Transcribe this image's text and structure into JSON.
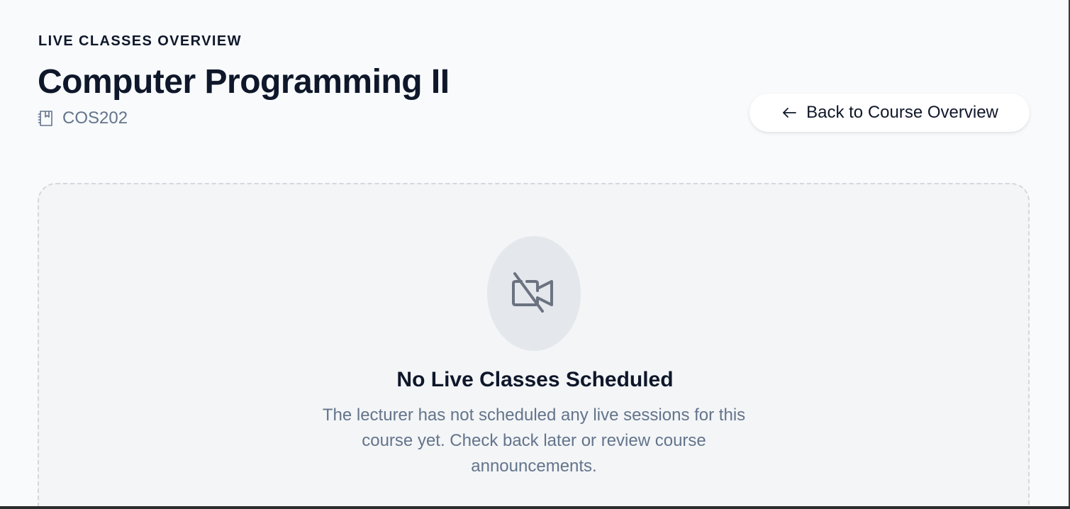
{
  "header": {
    "eyebrow": "LIVE CLASSES OVERVIEW",
    "course_title": "Computer Programming II",
    "course_code": "COS202",
    "course_code_icon": "book-icon"
  },
  "actions": {
    "back_label": "Back to Course Overview",
    "back_icon": "arrow-left-icon"
  },
  "empty_state": {
    "icon": "video-off-icon",
    "title": "No Live Classes Scheduled",
    "description": "The lecturer has not scheduled any live sessions for this course yet. Check back later or review course announcements."
  },
  "colors": {
    "background": "#f8fafc",
    "heading": "#0f172a",
    "muted": "#64748b",
    "panel": "#f3f5f7",
    "icon_circle": "#e4e7eb"
  }
}
